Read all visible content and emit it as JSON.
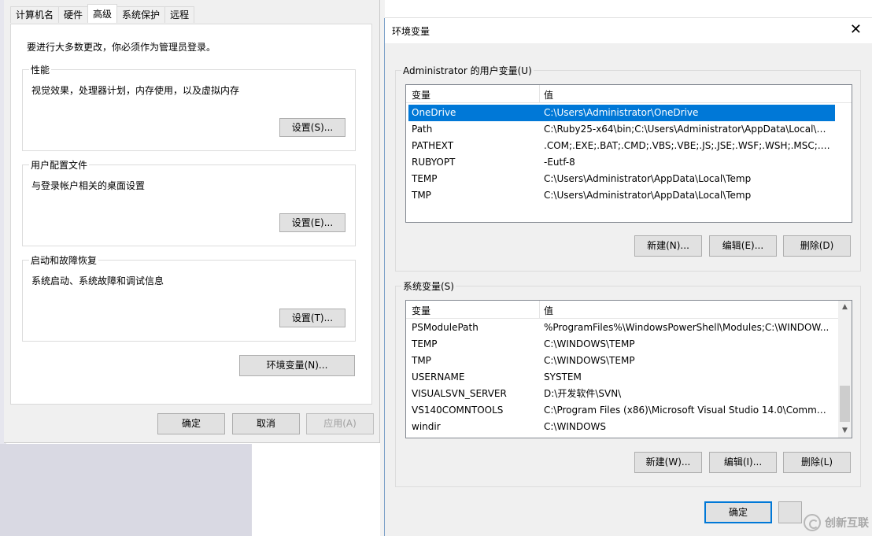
{
  "sysprop": {
    "tabs": [
      "计算机名",
      "硬件",
      "高级",
      "系统保护",
      "远程"
    ],
    "active_tab": "高级",
    "admin_note": "要进行大多数更改，你必须作为管理员登录。",
    "performance": {
      "title": "性能",
      "desc": "视觉效果，处理器计划，内存使用，以及虚拟内存",
      "button": "设置(S)..."
    },
    "profile": {
      "title": "用户配置文件",
      "desc": "与登录帐户相关的桌面设置",
      "button": "设置(E)..."
    },
    "startup": {
      "title": "启动和故障恢复",
      "desc": "系统启动、系统故障和调试信息",
      "button": "设置(T)..."
    },
    "env_button": "环境变量(N)...",
    "ok": "确定",
    "cancel": "取消",
    "apply": "应用(A)"
  },
  "env": {
    "title": "环境变量",
    "user_group_title": "Administrator 的用户变量(U)",
    "col_var": "变量",
    "col_val": "值",
    "user_vars": [
      {
        "name": "OneDrive",
        "value": "C:\\Users\\Administrator\\OneDrive",
        "selected": true
      },
      {
        "name": "Path",
        "value": "C:\\Ruby25-x64\\bin;C:\\Users\\Administrator\\AppData\\Local\\Mi..."
      },
      {
        "name": "PATHEXT",
        "value": ".COM;.EXE;.BAT;.CMD;.VBS;.VBE;.JS;.JSE;.WSF;.WSH;.MSC;.RB;...."
      },
      {
        "name": "RUBYOPT",
        "value": "-Eutf-8"
      },
      {
        "name": "TEMP",
        "value": "C:\\Users\\Administrator\\AppData\\Local\\Temp"
      },
      {
        "name": "TMP",
        "value": "C:\\Users\\Administrator\\AppData\\Local\\Temp"
      }
    ],
    "user_new": "新建(N)...",
    "user_edit": "编辑(E)...",
    "user_delete": "删除(D)",
    "sys_group_title": "系统变量(S)",
    "sys_vars": [
      {
        "name": "PSModulePath",
        "value": "%ProgramFiles%\\WindowsPowerShell\\Modules;C:\\WINDOW..."
      },
      {
        "name": "TEMP",
        "value": "C:\\WINDOWS\\TEMP"
      },
      {
        "name": "TMP",
        "value": "C:\\WINDOWS\\TEMP"
      },
      {
        "name": "USERNAME",
        "value": "SYSTEM"
      },
      {
        "name": "VISUALSVN_SERVER",
        "value": "D:\\开发软件\\SVN\\"
      },
      {
        "name": "VS140COMNTOOLS",
        "value": "C:\\Program Files (x86)\\Microsoft Visual Studio 14.0\\Common..."
      },
      {
        "name": "windir",
        "value": "C:\\WINDOWS"
      }
    ],
    "sys_new": "新建(W)...",
    "sys_edit": "编辑(I)...",
    "sys_delete": "删除(L)",
    "ok": "确定",
    "close_glyph": "✕",
    "scroll_up_glyph": "▲",
    "scroll_down_glyph": "▼"
  },
  "watermark": {
    "text": "创新互联",
    "icon": "logo-icon"
  }
}
